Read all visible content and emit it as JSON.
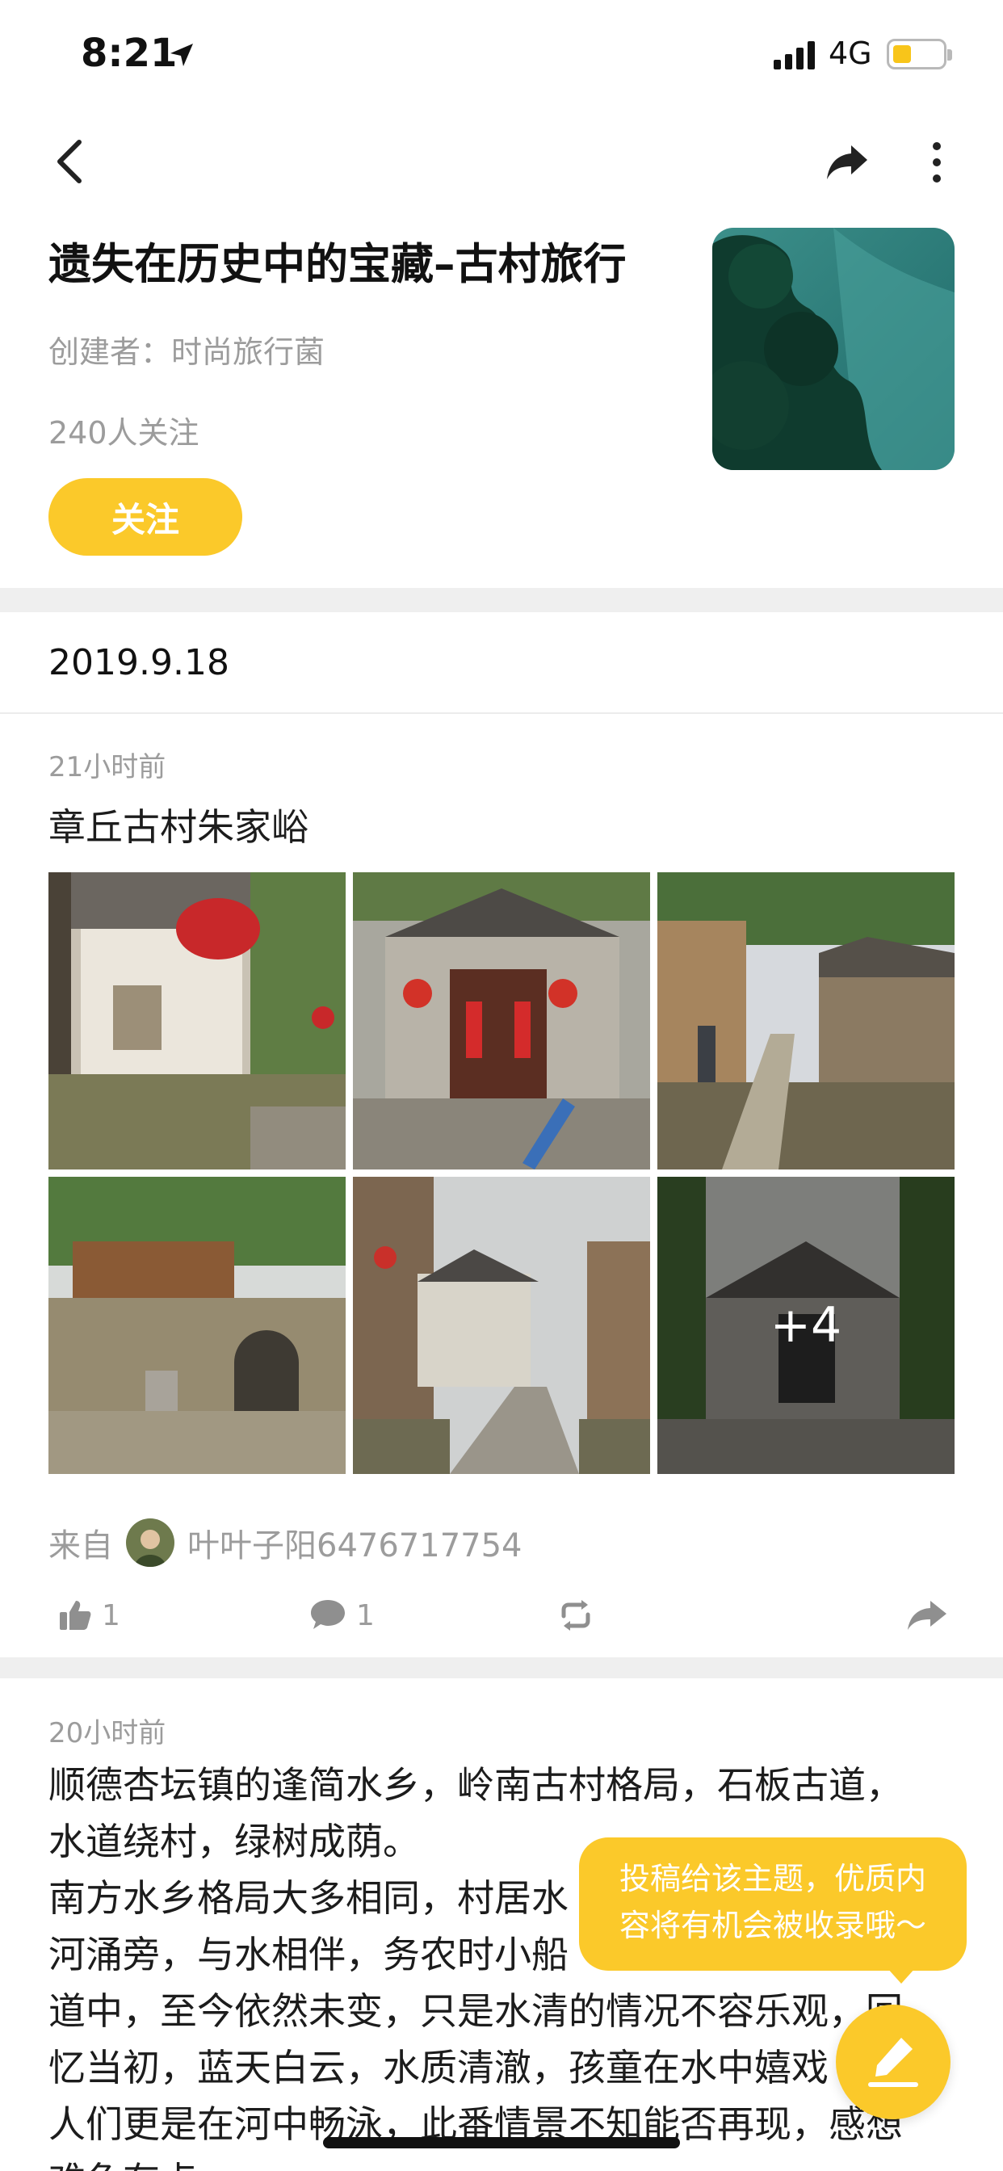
{
  "status_bar": {
    "time": "8:21",
    "network": "4G",
    "battery_color": "#f8c51a"
  },
  "nav": {
    "back_icon": "back-chevron-icon",
    "share_icon": "share-icon",
    "more_icon": "more-vertical-icon"
  },
  "header": {
    "title": "遗失在历史中的宝藏–古村旅行",
    "creator": "创建者：时尚旅行菌",
    "followers": "240人关注",
    "follow_label": "关注",
    "accent_color": "#fbc92a"
  },
  "date_group": "2019.9.18",
  "post1": {
    "time_ago": "21小时前",
    "title": "章丘古村朱家峪",
    "more_photos": "+4",
    "source_label": "来自",
    "author": "叶叶子阳6476717754",
    "likes": "1",
    "comments": "1"
  },
  "post2": {
    "time_ago": "20小时前",
    "lines": [
      "顺德杏坛镇的逢简水乡，岭南古村格局，石板古道，",
      "水道绕村，绿树成荫。",
      "南方水乡格局大多相同，村居水",
      "河涌旁，与水相伴，务农时小船",
      "道中，至今依然未变，只是水清的情况不容乐观，回",
      "忆当初，蓝天白云，水质清澈，孩童在水中嬉戏",
      "人们更是在河中畅泳，此番情景不知能否再现，感想",
      "难免有点"
    ]
  },
  "tooltip": {
    "line1": "投稿给该主题，优质内",
    "line2": "容将有机会被收录哦～"
  },
  "fab_icon": "edit-pen-icon"
}
